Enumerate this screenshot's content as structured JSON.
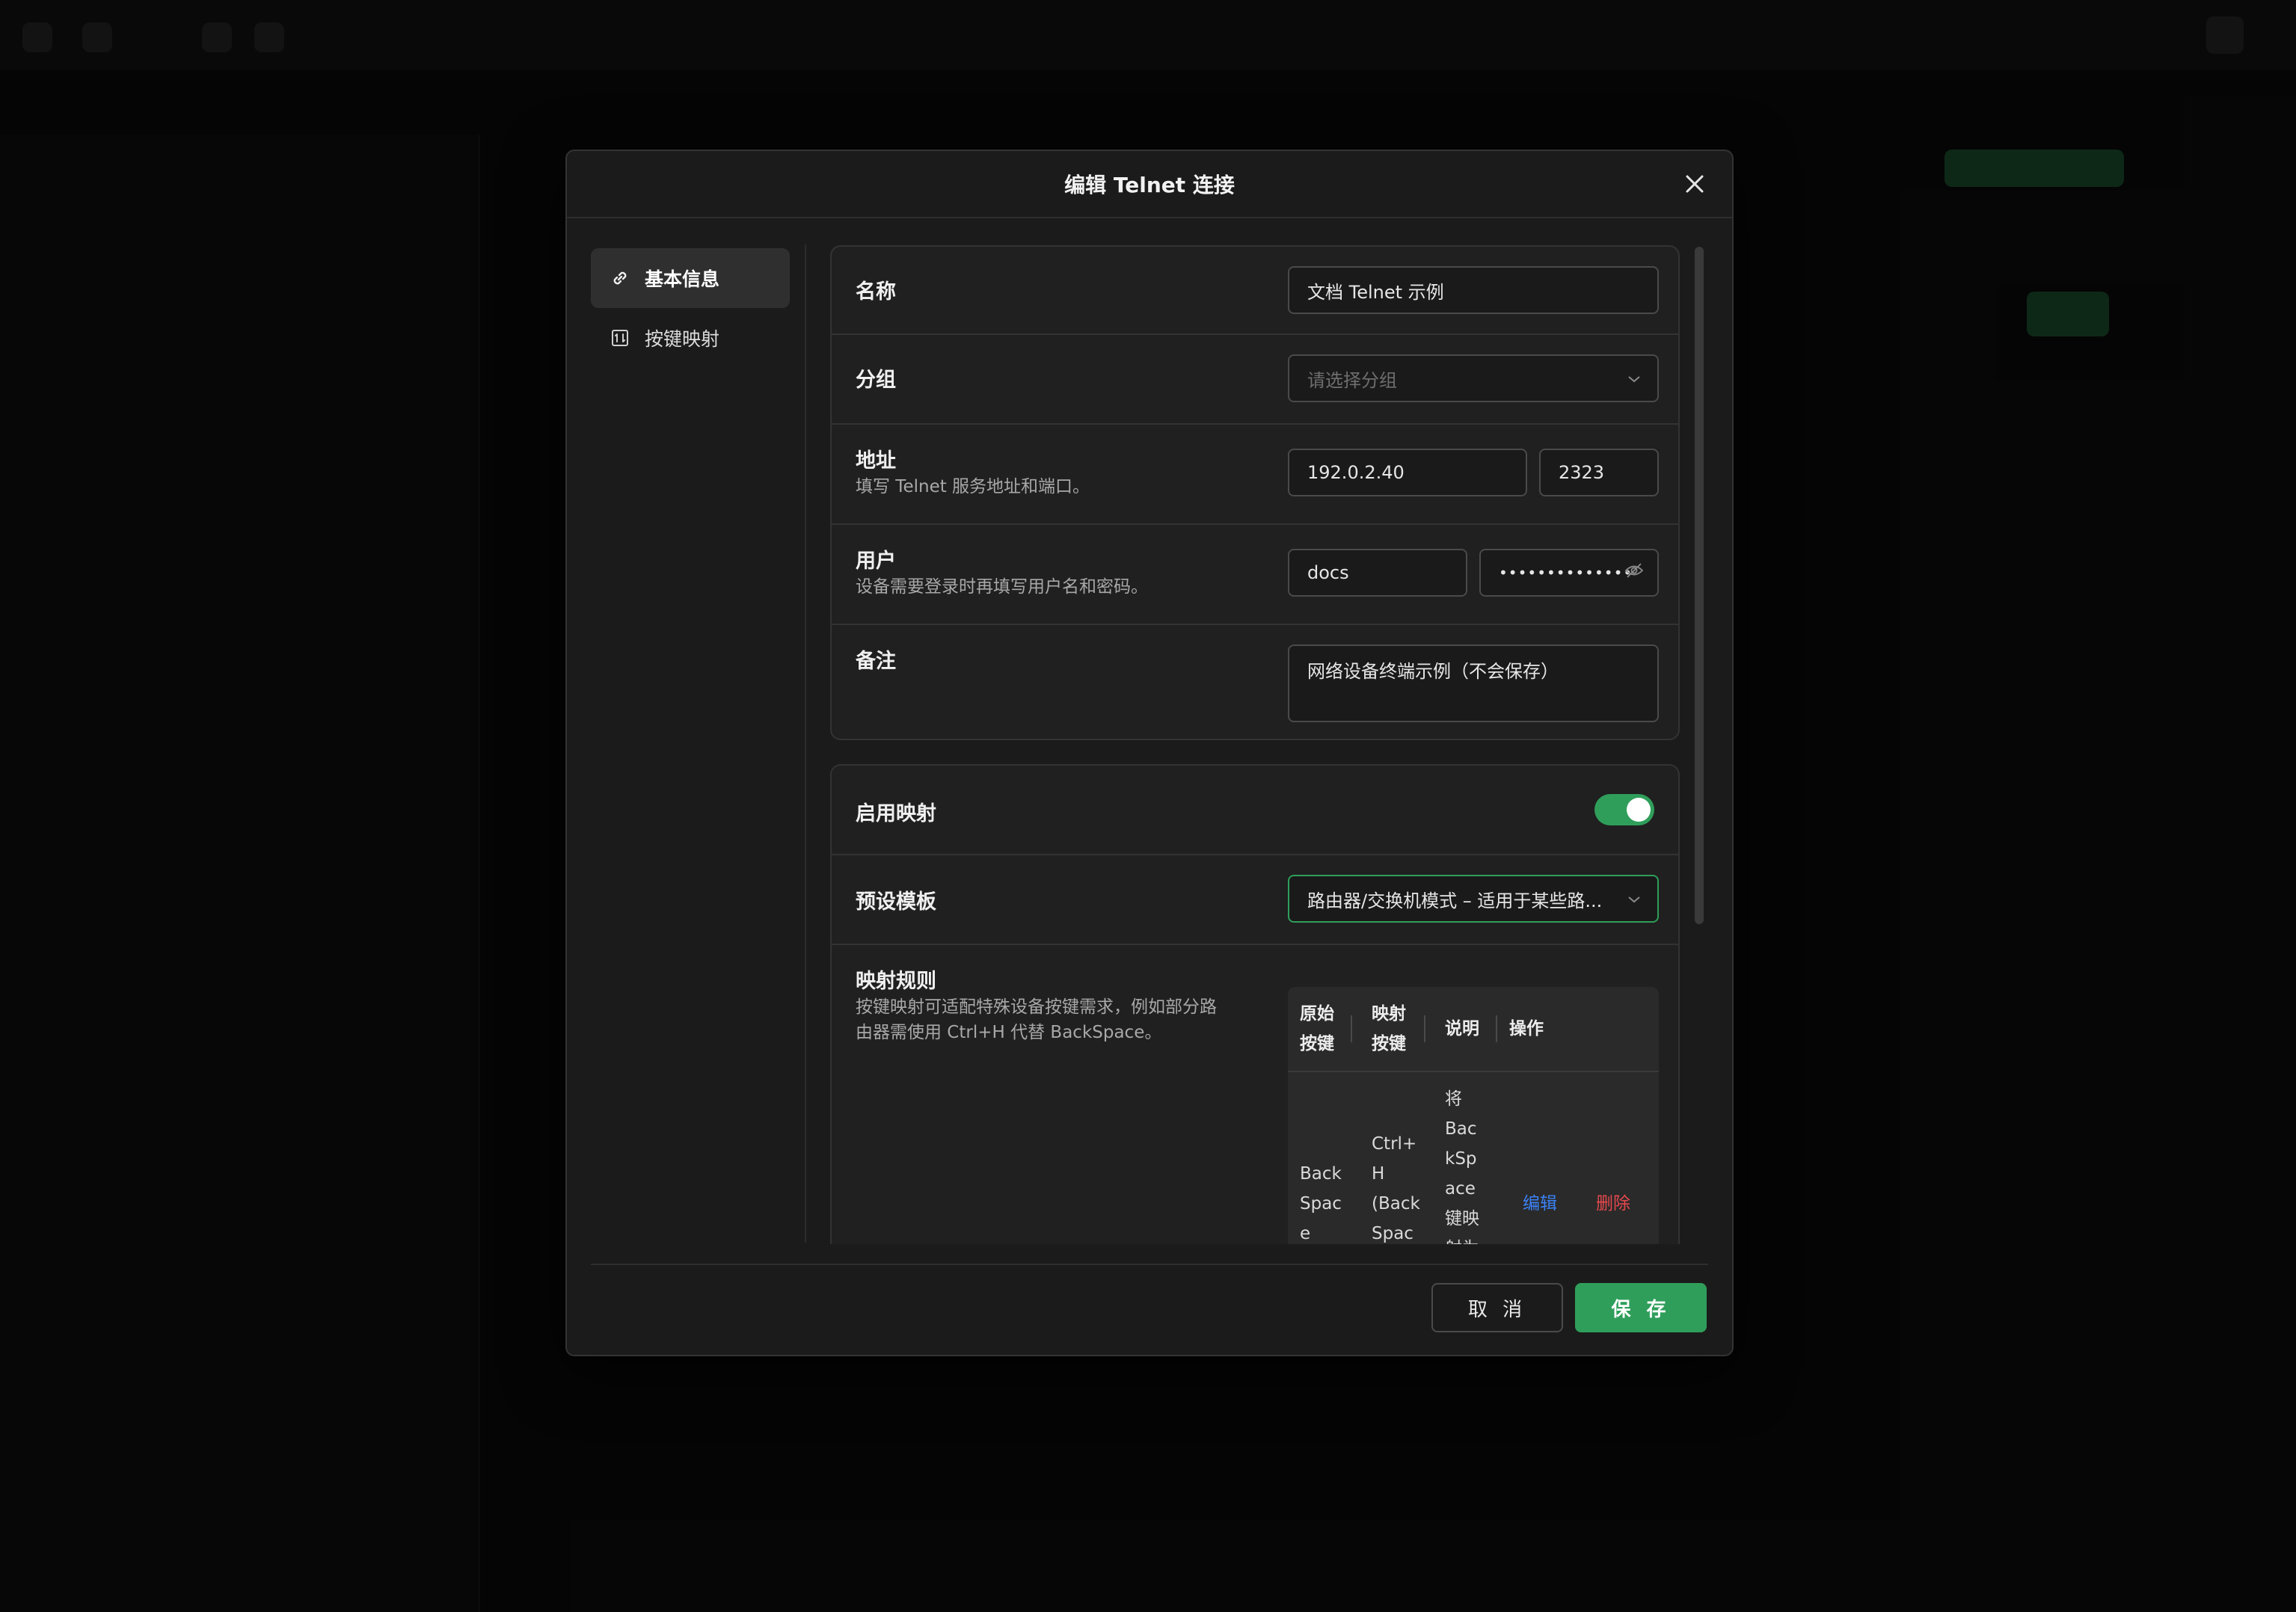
{
  "dialog": {
    "title": "编辑 Telnet 连接",
    "close_icon": "close-icon"
  },
  "nav": {
    "items": [
      {
        "label": "基本信息",
        "icon": "link-icon",
        "active": true
      },
      {
        "label": "按键映射",
        "icon": "keymap-icon",
        "active": false
      }
    ]
  },
  "basic": {
    "name": {
      "label": "名称",
      "value": "文档 Telnet 示例"
    },
    "group": {
      "label": "分组",
      "placeholder": "请选择分组"
    },
    "address": {
      "label": "地址",
      "desc": "填写 Telnet 服务地址和端口。",
      "host": "192.0.2.40",
      "port": "2323"
    },
    "user": {
      "label": "用户",
      "desc": "设备需要登录时再填写用户名和密码。",
      "username": "docs",
      "password_mask": "••••••••••••••"
    },
    "note": {
      "label": "备注",
      "value": "网络设备终端示例（不会保存）"
    }
  },
  "mapping": {
    "enable_label": "启用映射",
    "enabled": true,
    "preset": {
      "label": "预设模板",
      "value": "路由器/交换机模式 – 适用于某些路..."
    },
    "rules": {
      "label": "映射规则",
      "desc_line1": "按键映射可适配特殊设备按键需求，例如部分路",
      "desc_line2": "由器需使用 Ctrl+H 代替 BackSpace。",
      "headers": {
        "original_1": "原始",
        "original_2": "按键",
        "mapped_1": "映射",
        "mapped_2": "按键",
        "desc": "说明",
        "ops": "操作"
      },
      "row": {
        "original": [
          "Back",
          "Spac",
          "e"
        ],
        "mapped": [
          "Ctrl+",
          "H",
          "(Back",
          "Spac"
        ],
        "desc": [
          "将",
          "Bac",
          "kSp",
          "ace",
          "键映",
          "射为"
        ],
        "edit": "编辑",
        "delete": "删除"
      }
    }
  },
  "footer": {
    "cancel": "取 消",
    "save": "保 存"
  },
  "colors": {
    "accent": "#2f9e5a",
    "link": "#3b82f6",
    "danger": "#e5484d"
  }
}
